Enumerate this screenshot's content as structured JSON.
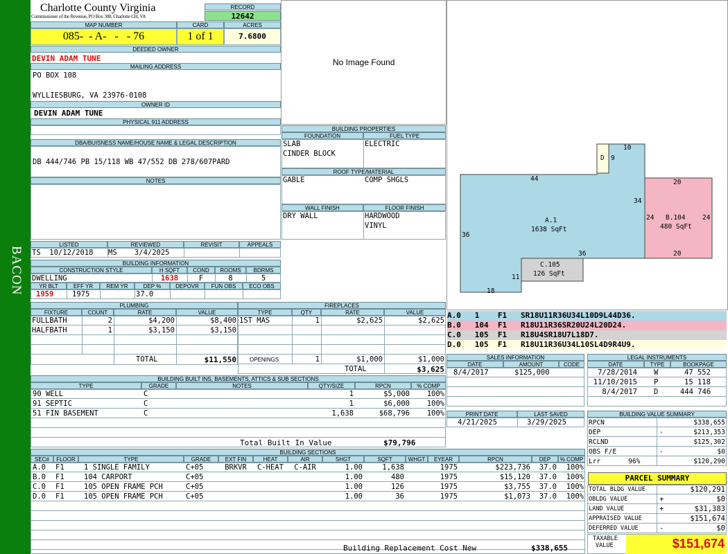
{
  "sidebar": {
    "label": "BACON"
  },
  "county": {
    "name": "Charlotte County Virginia",
    "sub": "Commissioner of the Revenue, PO Box 308, Charlotte CH, VA"
  },
  "record": {
    "label": "RECORD",
    "value": "12642"
  },
  "map": {
    "label": "MAP NUMBER",
    "value": "085-  - A-   -   - 76"
  },
  "card": {
    "label": "CARD",
    "value": "1 of 1"
  },
  "acres": {
    "label": "ACRES",
    "value": "7.6800"
  },
  "deeded_owner": {
    "label": "DEEDED OWNER",
    "value": "DEVIN ADAM TUNE"
  },
  "mailing": {
    "label": "MAILING ADDRESS",
    "line1": "PO BOX 108",
    "line2": "WYLLIESBURG, VA 23976-0108"
  },
  "owner_id": {
    "label": "OWNER ID",
    "value": "DEVIN ADAM TUNE"
  },
  "physical": {
    "label": "PHYSICAL 911 ADDRESS",
    "value": ""
  },
  "dba": {
    "label": "DBA/BUISNESS NAME/HOUSE NAME & LEGAL DESCRIPTION",
    "value": "DB 444/746 PB 15/118 WB 47/552 DB 278/607PARD"
  },
  "notes": {
    "label": "NOTES"
  },
  "image": {
    "text": "No Image Found"
  },
  "listed": {
    "label": "LISTED",
    "value": "TS  10/12/2018"
  },
  "reviewed": {
    "label": "REVIEWED",
    "value": "MS    3/4/2025"
  },
  "revisit": {
    "label": "REVISIT"
  },
  "appeals": {
    "label": "APPEALS"
  },
  "bldg_info": {
    "label": "BUILDING INFORMATION",
    "h_construction": "CONSTRUCTION STYLE",
    "h_hsqft": "H SQFT",
    "h_cond": "COND",
    "h_rooms": "ROOMS",
    "h_bdrms": "BDRMS",
    "construction": "DWELLING",
    "hsqft": "1638",
    "cond": "F",
    "rooms": "8",
    "bdrms": "5",
    "h_yrblt": "YR BLT",
    "h_effyr": "EFF YR",
    "h_remyr": "REM YR",
    "h_dep": "DEP %",
    "h_depovr": "DEPOVR",
    "h_funobs": "FUN OBS",
    "h_ecoobs": "ECO OBS",
    "yrblt": "1959",
    "effyr": "1975",
    "dep": "37.0"
  },
  "bldg_props": {
    "label": "BUILDING PROPERTIES",
    "foundation_label": "FOUNDATION",
    "fuel_label": "FUEL TYPE",
    "foundation": [
      "SLAB",
      "CINDER BLOCK"
    ],
    "fuel": "ELECTRIC",
    "roof_label": "ROOF TYPE/MATERIAL",
    "roof_type": "GABLE",
    "roof_mat": "COMP SHGLS",
    "wall_label": "WALL FINISH",
    "floor_label": "FLOOR FINISH",
    "wall": "DRY WALL",
    "floor": [
      "HARDWOOD",
      "VINYL"
    ]
  },
  "plumbing": {
    "label": "PLUMBING",
    "headers": [
      "FIXTURE",
      "COUNT",
      "RATE",
      "VALUE"
    ],
    "rows": [
      [
        "FULLBATH",
        "2",
        "$4,200",
        "$8,400"
      ],
      [
        "HALFBATH",
        "1",
        "$3,150",
        "$3,150"
      ]
    ],
    "total_label": "TOTAL",
    "total": "$11,550"
  },
  "fireplaces": {
    "label": "FIREPLACES",
    "headers": [
      "TYPE",
      "QTY",
      "RATE",
      "VALUE"
    ],
    "rows": [
      [
        "1ST MAS",
        "1",
        "$2,625",
        "$2,625"
      ]
    ],
    "openings_label": "OPENINGS",
    "openings": [
      "1",
      "$1,000",
      "$1,000"
    ],
    "total_label": "TOTAL",
    "total": "$3,625"
  },
  "builtins": {
    "label": "BUILDING BUILT INS, BASEMENTS, ATTICS & SUB SECTIONS",
    "headers": [
      "TYPE",
      "GRADE",
      "NOTES",
      "QTY/SIZE",
      "RPCN",
      "% COMP"
    ],
    "rows": [
      [
        "90 WELL",
        "C",
        "",
        "1",
        "$5,000",
        "100%"
      ],
      [
        "91 SEPTIC",
        "C",
        "",
        "1",
        "$6,000",
        "100%"
      ],
      [
        "51 FIN BASEMENT",
        "C",
        "",
        "1,638",
        "$68,796",
        "100%"
      ]
    ],
    "total_label": "Total Built In Value",
    "total": "$79,796"
  },
  "sections": {
    "label": "BUILDING SECTIONS",
    "headers": [
      "SEC#",
      "FLOOR",
      "TYPE",
      "GRADE",
      "EXT FIN",
      "HEAT",
      "AIR",
      "SHGT",
      "SQFT",
      "WHGT",
      "EYEAR",
      "RPCN",
      "DEP",
      "% COMP"
    ],
    "rows": [
      [
        "A.0",
        "F1",
        "1 SINGLE FAMILY",
        "C+05",
        "BRKVR",
        "C-HEAT",
        "C-AIR",
        "1.00",
        "1,638",
        "",
        "1975",
        "$223,736",
        "37.0",
        "100%"
      ],
      [
        "B.0",
        "F1",
        "104 CARPORT",
        "C+05",
        "",
        "",
        "",
        "1.00",
        "480",
        "",
        "1975",
        "$15,120",
        "37.0",
        "100%"
      ],
      [
        "C.0",
        "F1",
        "105 OPEN FRAME PCH",
        "C+05",
        "",
        "",
        "",
        "1.00",
        "126",
        "",
        "1975",
        "$3,755",
        "37.0",
        "100%"
      ],
      [
        "D.0",
        "F1",
        "105 OPEN FRAME PCH",
        "C+05",
        "",
        "",
        "",
        "1.00",
        "36",
        "",
        "1975",
        "$1,073",
        "37.0",
        "100%"
      ]
    ],
    "rcn_label": "Building Replacement Cost New",
    "rcn": "$338,655"
  },
  "sketch": {
    "a_label": "A.1",
    "a_area": "1638 SqFt",
    "b_label": "B.104",
    "b_area": "480 SqFt",
    "c_label": "C.105",
    "c_area": "126 SqFt",
    "d_label": "D",
    "dims": {
      "d44": "44",
      "d36l": "36",
      "d36b": "36",
      "d34": "34",
      "d18": "18",
      "d11": "11",
      "d10": "10",
      "d9": "9",
      "d20t": "20",
      "d20b": "20",
      "d24l": "24",
      "d24r": "24"
    },
    "colors": {
      "a": "#add8e6",
      "b": "#f4b6c2",
      "c": "#d3d3d3",
      "d": "#fffde0"
    }
  },
  "legend": [
    {
      "text": "A.0   1    F1   SR18U11R36U34L10D9L44D36.",
      "color": "#add8e6"
    },
    {
      "text": "B.0   104  F1   R18U11R36SR20U24L20D24.",
      "color": "#f4b6c2"
    },
    {
      "text": "C.0   105  F1   R18U4SR18U7L18D7.",
      "color": "#d3d3d3"
    },
    {
      "text": "D.0   105  F1   R18U11R36U34L10SL4D9R4U9.",
      "color": "#fffde0"
    }
  ],
  "sales": {
    "label": "SALES INFORMATION",
    "headers": [
      "DATE",
      "AMOUNT",
      "CODE"
    ],
    "rows": [
      [
        "8/4/2017",
        "$125,000",
        ""
      ]
    ]
  },
  "legal": {
    "label": "LEGAL INSTRUMENTS",
    "headers": [
      "DATE",
      "TYPE",
      "BOOKPAGE"
    ],
    "rows": [
      [
        "7/28/2014",
        "W",
        "47 552"
      ],
      [
        "11/10/2015",
        "P",
        "15 118"
      ],
      [
        "8/4/2017",
        "D",
        "444 746"
      ]
    ]
  },
  "print": {
    "label": "PRINT DATE",
    "value": "4/21/2025"
  },
  "saved": {
    "label": "LAST SAVED",
    "value": "3/29/2025"
  },
  "bvs": {
    "label": "BUILDING VALUE SUMMARY",
    "rows": [
      [
        "RPCN",
        "",
        "$338,655"
      ],
      [
        "DEP",
        "-",
        "$213,353"
      ],
      [
        "RCLND",
        "",
        "$125,302"
      ],
      [
        "OBS F/E",
        "-",
        "$0"
      ],
      [
        "Lrr       96%",
        "",
        "$120,290"
      ]
    ]
  },
  "parcel": {
    "label": "PARCEL SUMMARY",
    "rows": [
      [
        "TOTAL BLDG VALUE",
        "",
        "$120,291"
      ],
      [
        "OBLDG VALUE",
        "+",
        "$0"
      ],
      [
        "LAND VALUE",
        "+",
        "$31,383"
      ],
      [
        "APPRAISED VALUE",
        "",
        "$151,674"
      ],
      [
        "DEFERRED VALUE",
        "-",
        "$0"
      ]
    ],
    "taxable_label1": "TAXABLE",
    "taxable_label2": "VALUE",
    "taxable": "$151,674"
  }
}
